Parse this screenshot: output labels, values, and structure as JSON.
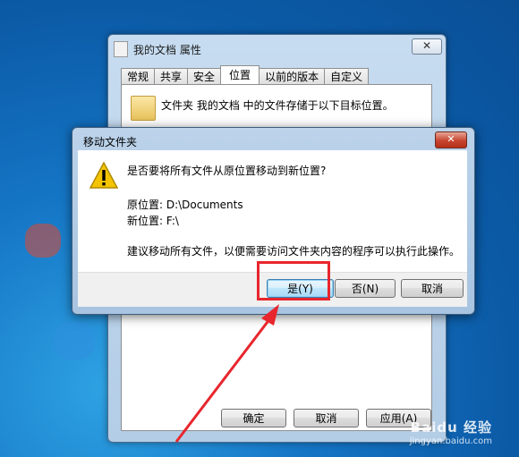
{
  "properties_window": {
    "title": "我的文档 属性",
    "close_glyph": "✕",
    "tabs": [
      "常规",
      "共享",
      "安全",
      "位置",
      "以前的版本",
      "自定义"
    ],
    "active_tab": "位置",
    "description": "文件夹 我的文档 中的文件存储于以下目标位置。",
    "buttons": {
      "ok": "确定",
      "cancel": "取消",
      "apply": "应用(A)"
    }
  },
  "dialog": {
    "title": "移动文件夹",
    "close_glyph": "✕",
    "question": "是否要将所有文件从原位置移动到新位置?",
    "original_location": "原位置: D:\\Documents",
    "new_location": "新位置: F:\\",
    "advice": "建议移动所有文件，以便需要访问文件夹内容的程序可以执行此操作。",
    "buttons": {
      "yes": "是(Y)",
      "no": "否(N)",
      "cancel": "取消"
    },
    "icon": "warning-icon"
  },
  "annotation": {
    "color": "#e8262d"
  },
  "watermark": {
    "logo": "Baidu 经验",
    "url": "jingyan.baidu.com"
  }
}
